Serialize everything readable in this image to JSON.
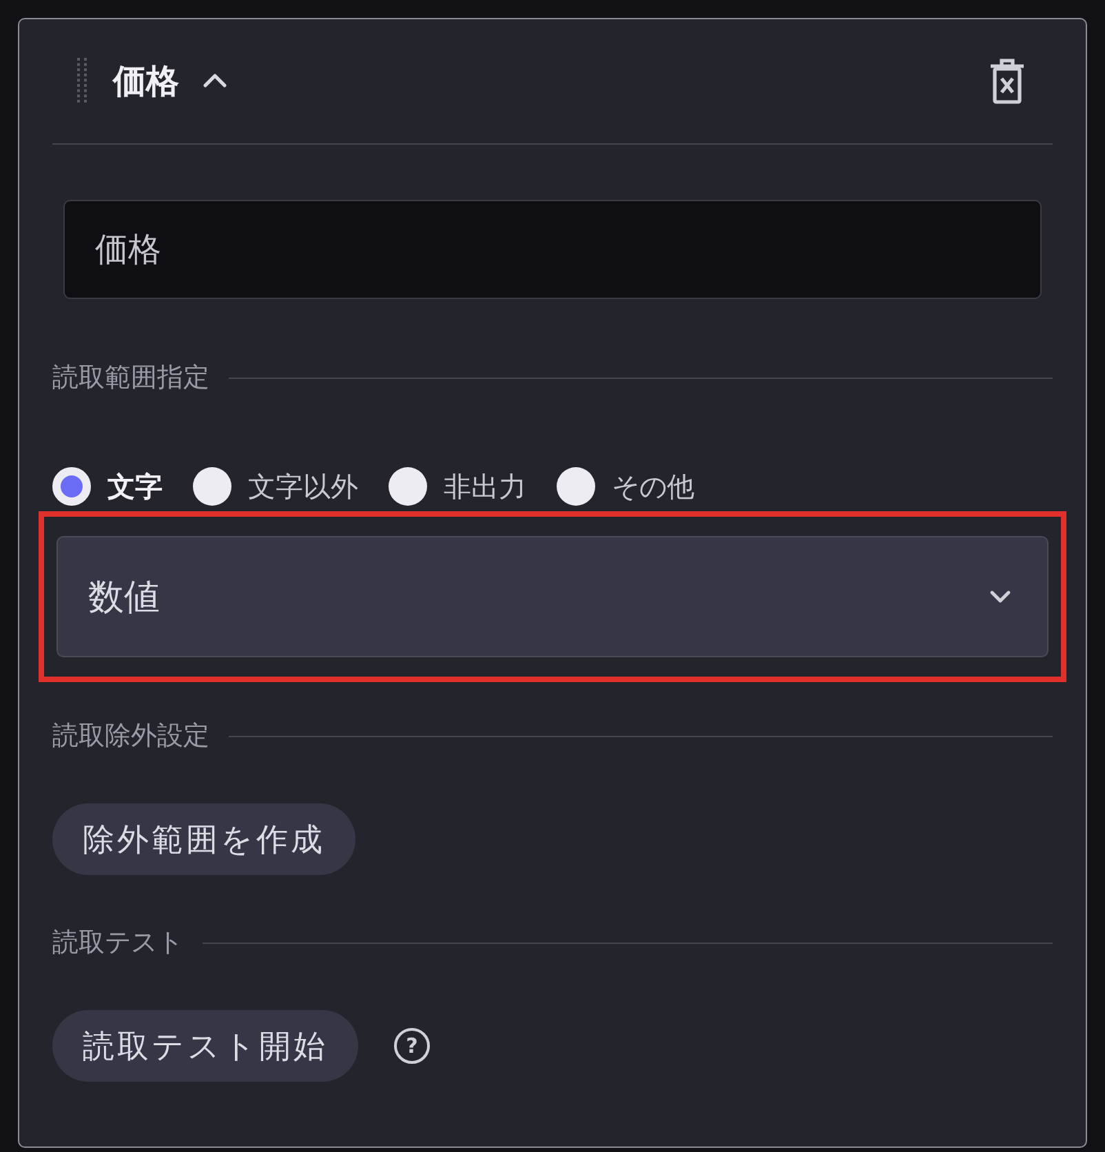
{
  "header": {
    "title": "価格",
    "expanded": true
  },
  "name_field": {
    "value": "価格"
  },
  "read_range": {
    "label": "読取範囲指定",
    "options": [
      {
        "label": "文字",
        "selected": true
      },
      {
        "label": "文字以外",
        "selected": false
      },
      {
        "label": "非出力",
        "selected": false
      },
      {
        "label": "その他",
        "selected": false
      }
    ],
    "select": {
      "value": "数値",
      "highlighted": true
    }
  },
  "exclude": {
    "label": "読取除外設定",
    "button": "除外範囲を作成"
  },
  "test": {
    "label": "読取テスト",
    "button": "読取テスト開始",
    "help": "?"
  }
}
